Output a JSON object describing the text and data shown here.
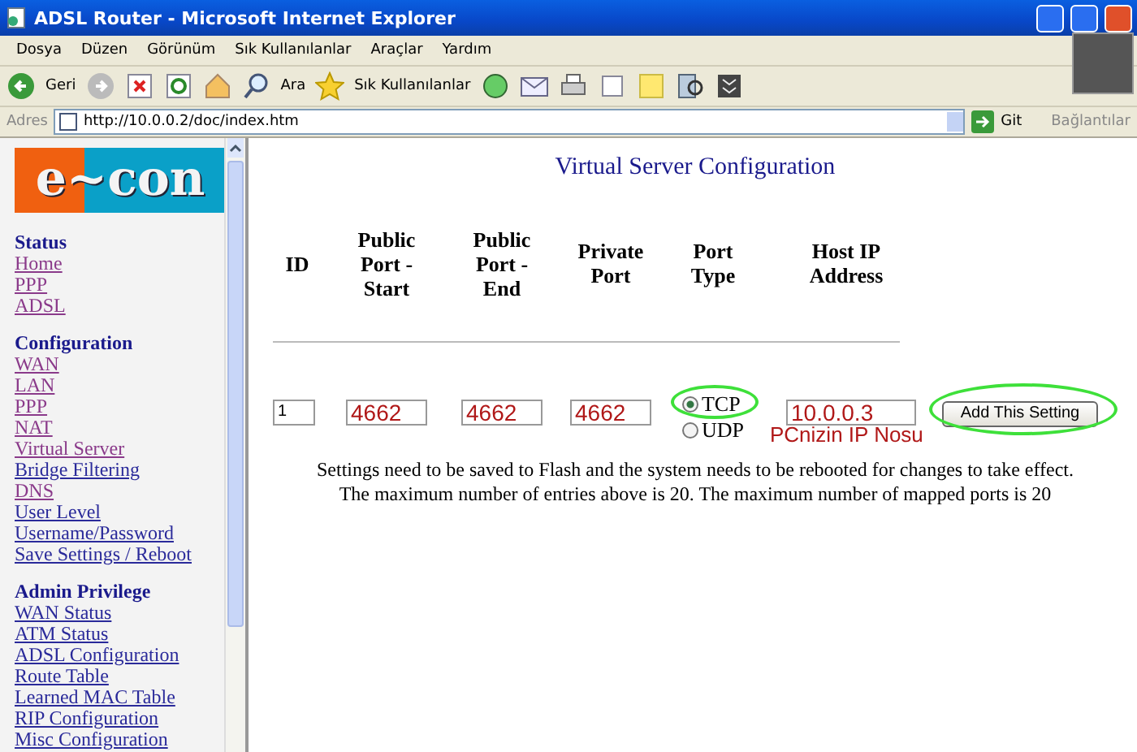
{
  "window": {
    "title": "ADSL Router - Microsoft Internet Explorer"
  },
  "menu": [
    "Dosya",
    "Düzen",
    "Görünüm",
    "Sık Kullanılanlar",
    "Araçlar",
    "Yardım"
  ],
  "toolbar": {
    "back": "Geri",
    "search": "Ara",
    "favorites": "Sık Kullanılanlar"
  },
  "address": {
    "label": "Adres",
    "url": "http://10.0.0.2/doc/index.htm",
    "go": "Git",
    "links": "Bağlantılar"
  },
  "sidebar": {
    "logo": "e~con",
    "sections": [
      {
        "heading": "Status",
        "items": [
          {
            "label": "Home",
            "visited": true
          },
          {
            "label": "PPP",
            "visited": true
          },
          {
            "label": "ADSL",
            "visited": true
          }
        ]
      },
      {
        "heading": "Configuration",
        "items": [
          {
            "label": "WAN",
            "visited": true
          },
          {
            "label": "LAN",
            "visited": true
          },
          {
            "label": "PPP",
            "visited": true
          },
          {
            "label": "NAT",
            "visited": true
          },
          {
            "label": "Virtual Server",
            "visited": true
          },
          {
            "label": "Bridge Filtering",
            "visited": false
          },
          {
            "label": "DNS",
            "visited": true
          },
          {
            "label": "User Level",
            "visited": false
          },
          {
            "label": "Username/Password",
            "visited": false
          },
          {
            "label": "Save Settings / Reboot",
            "visited": false
          }
        ]
      },
      {
        "heading": "Admin Privilege",
        "items": [
          {
            "label": "WAN Status",
            "visited": false
          },
          {
            "label": "ATM Status",
            "visited": false
          },
          {
            "label": "ADSL Configuration",
            "visited": false
          },
          {
            "label": "Route Table",
            "visited": false
          },
          {
            "label": "Learned MAC Table",
            "visited": false
          },
          {
            "label": "RIP Configuration",
            "visited": false
          },
          {
            "label": "Misc Configuration",
            "visited": false
          }
        ]
      }
    ]
  },
  "page": {
    "title": "Virtual Server Configuration",
    "columns": [
      "ID",
      "Public Port - Start",
      "Public Port - End",
      "Private Port",
      "Port Type",
      "Host IP Address"
    ],
    "row": {
      "id": "1",
      "public_start": "4662",
      "public_end": "4662",
      "private_port": "4662",
      "port_types": [
        {
          "label": "TCP",
          "selected": true
        },
        {
          "label": "UDP",
          "selected": false
        }
      ],
      "host_ip": "10.0.0.3",
      "host_note": "PCnizin IP Nosu",
      "button": "Add This Setting"
    },
    "notes": [
      "Settings need to be saved to Flash and the system needs to be rebooted for changes to take effect.",
      "The maximum number of entries above is 20. The maximum number of mapped ports is 20"
    ]
  }
}
